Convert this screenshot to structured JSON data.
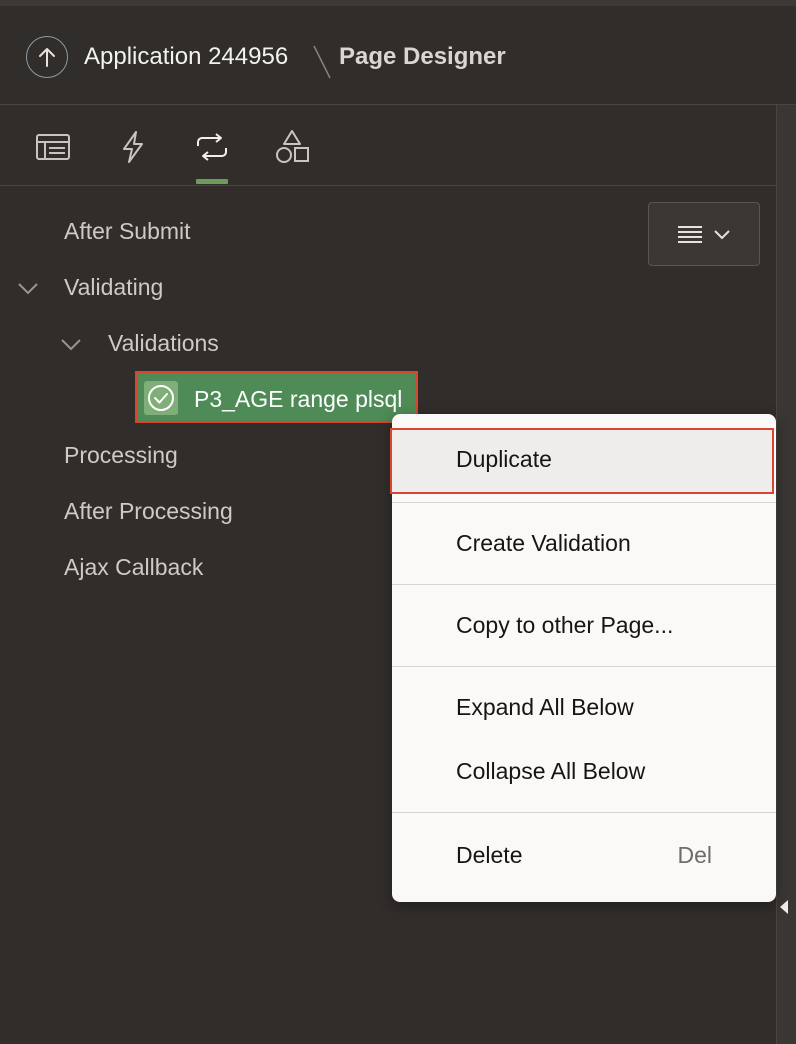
{
  "header": {
    "app_title": "Application 244956",
    "page_title": "Page Designer"
  },
  "tabs": [
    {
      "icon": "rendering-icon",
      "active": false
    },
    {
      "icon": "dynamic-actions-icon",
      "active": false
    },
    {
      "icon": "processing-icon",
      "active": true
    },
    {
      "icon": "shared-components-icon",
      "active": false
    }
  ],
  "tree": {
    "nodes": [
      {
        "label": "After Submit"
      },
      {
        "label": "Validating"
      },
      {
        "label": "Validations"
      },
      {
        "label": "P3_AGE range plsql"
      },
      {
        "label": "Processing"
      },
      {
        "label": "After Processing"
      },
      {
        "label": "Ajax Callback"
      }
    ]
  },
  "context_menu": {
    "items": [
      {
        "label": "Duplicate",
        "shortcut": ""
      },
      {
        "label": "Create Validation",
        "shortcut": ""
      },
      {
        "label": "Copy to other Page...",
        "shortcut": ""
      },
      {
        "label": "Expand All Below",
        "shortcut": ""
      },
      {
        "label": "Collapse All Below",
        "shortcut": ""
      },
      {
        "label": "Delete",
        "shortcut": "Del"
      }
    ]
  },
  "colors": {
    "background": "#312d2a",
    "accent": "#6e9a5e",
    "selection": "#4f8b56",
    "highlight_border": "#d9452e"
  }
}
